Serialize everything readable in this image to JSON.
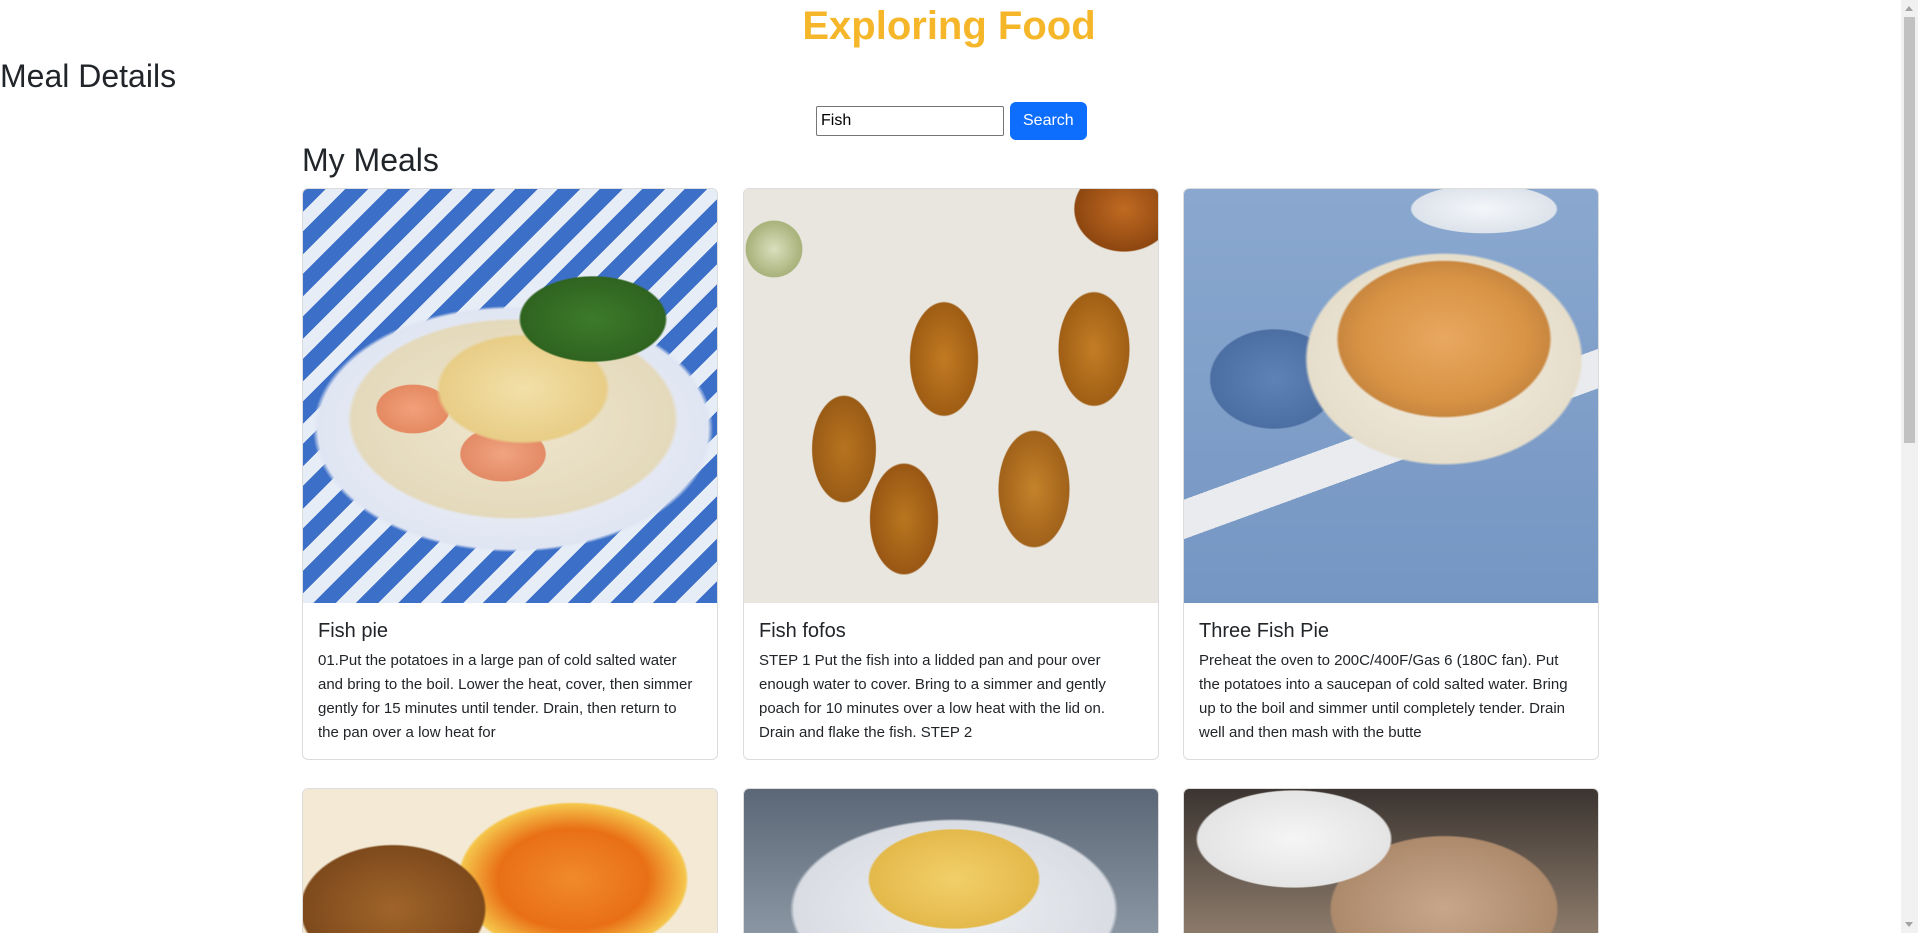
{
  "header": {
    "app_title": "Exploring Food",
    "section_title": "Meal Details"
  },
  "search": {
    "value": "Fish",
    "button_label": "Search"
  },
  "meals": {
    "heading": "My Meals",
    "cards": [
      {
        "title": "Fish pie",
        "text": "01.Put the potatoes in a large pan of cold salted water and bring to the boil. Lower the heat, cover, then simmer gently for 15 minutes until tender. Drain, then return to the pan over a low heat for",
        "image_alt": "Fish pie"
      },
      {
        "title": "Fish fofos",
        "text": "STEP 1 Put the fish into a lidded pan and pour over enough water to cover. Bring to a simmer and gently poach for 10 minutes over a low heat with the lid on. Drain and flake the fish. STEP 2",
        "image_alt": "Fish fofos"
      },
      {
        "title": "Three Fish Pie",
        "text": "Preheat the oven to 200C/400F/Gas 6 (180C fan). Put the potatoes into a saucepan of cold salted water. Bring up to the boil and simmer until completely tender. Drain well and then mash with the butte",
        "image_alt": "Three Fish Pie"
      }
    ]
  },
  "colors": {
    "brand": "#f5b62a",
    "primary_button": "#0d6efd"
  }
}
